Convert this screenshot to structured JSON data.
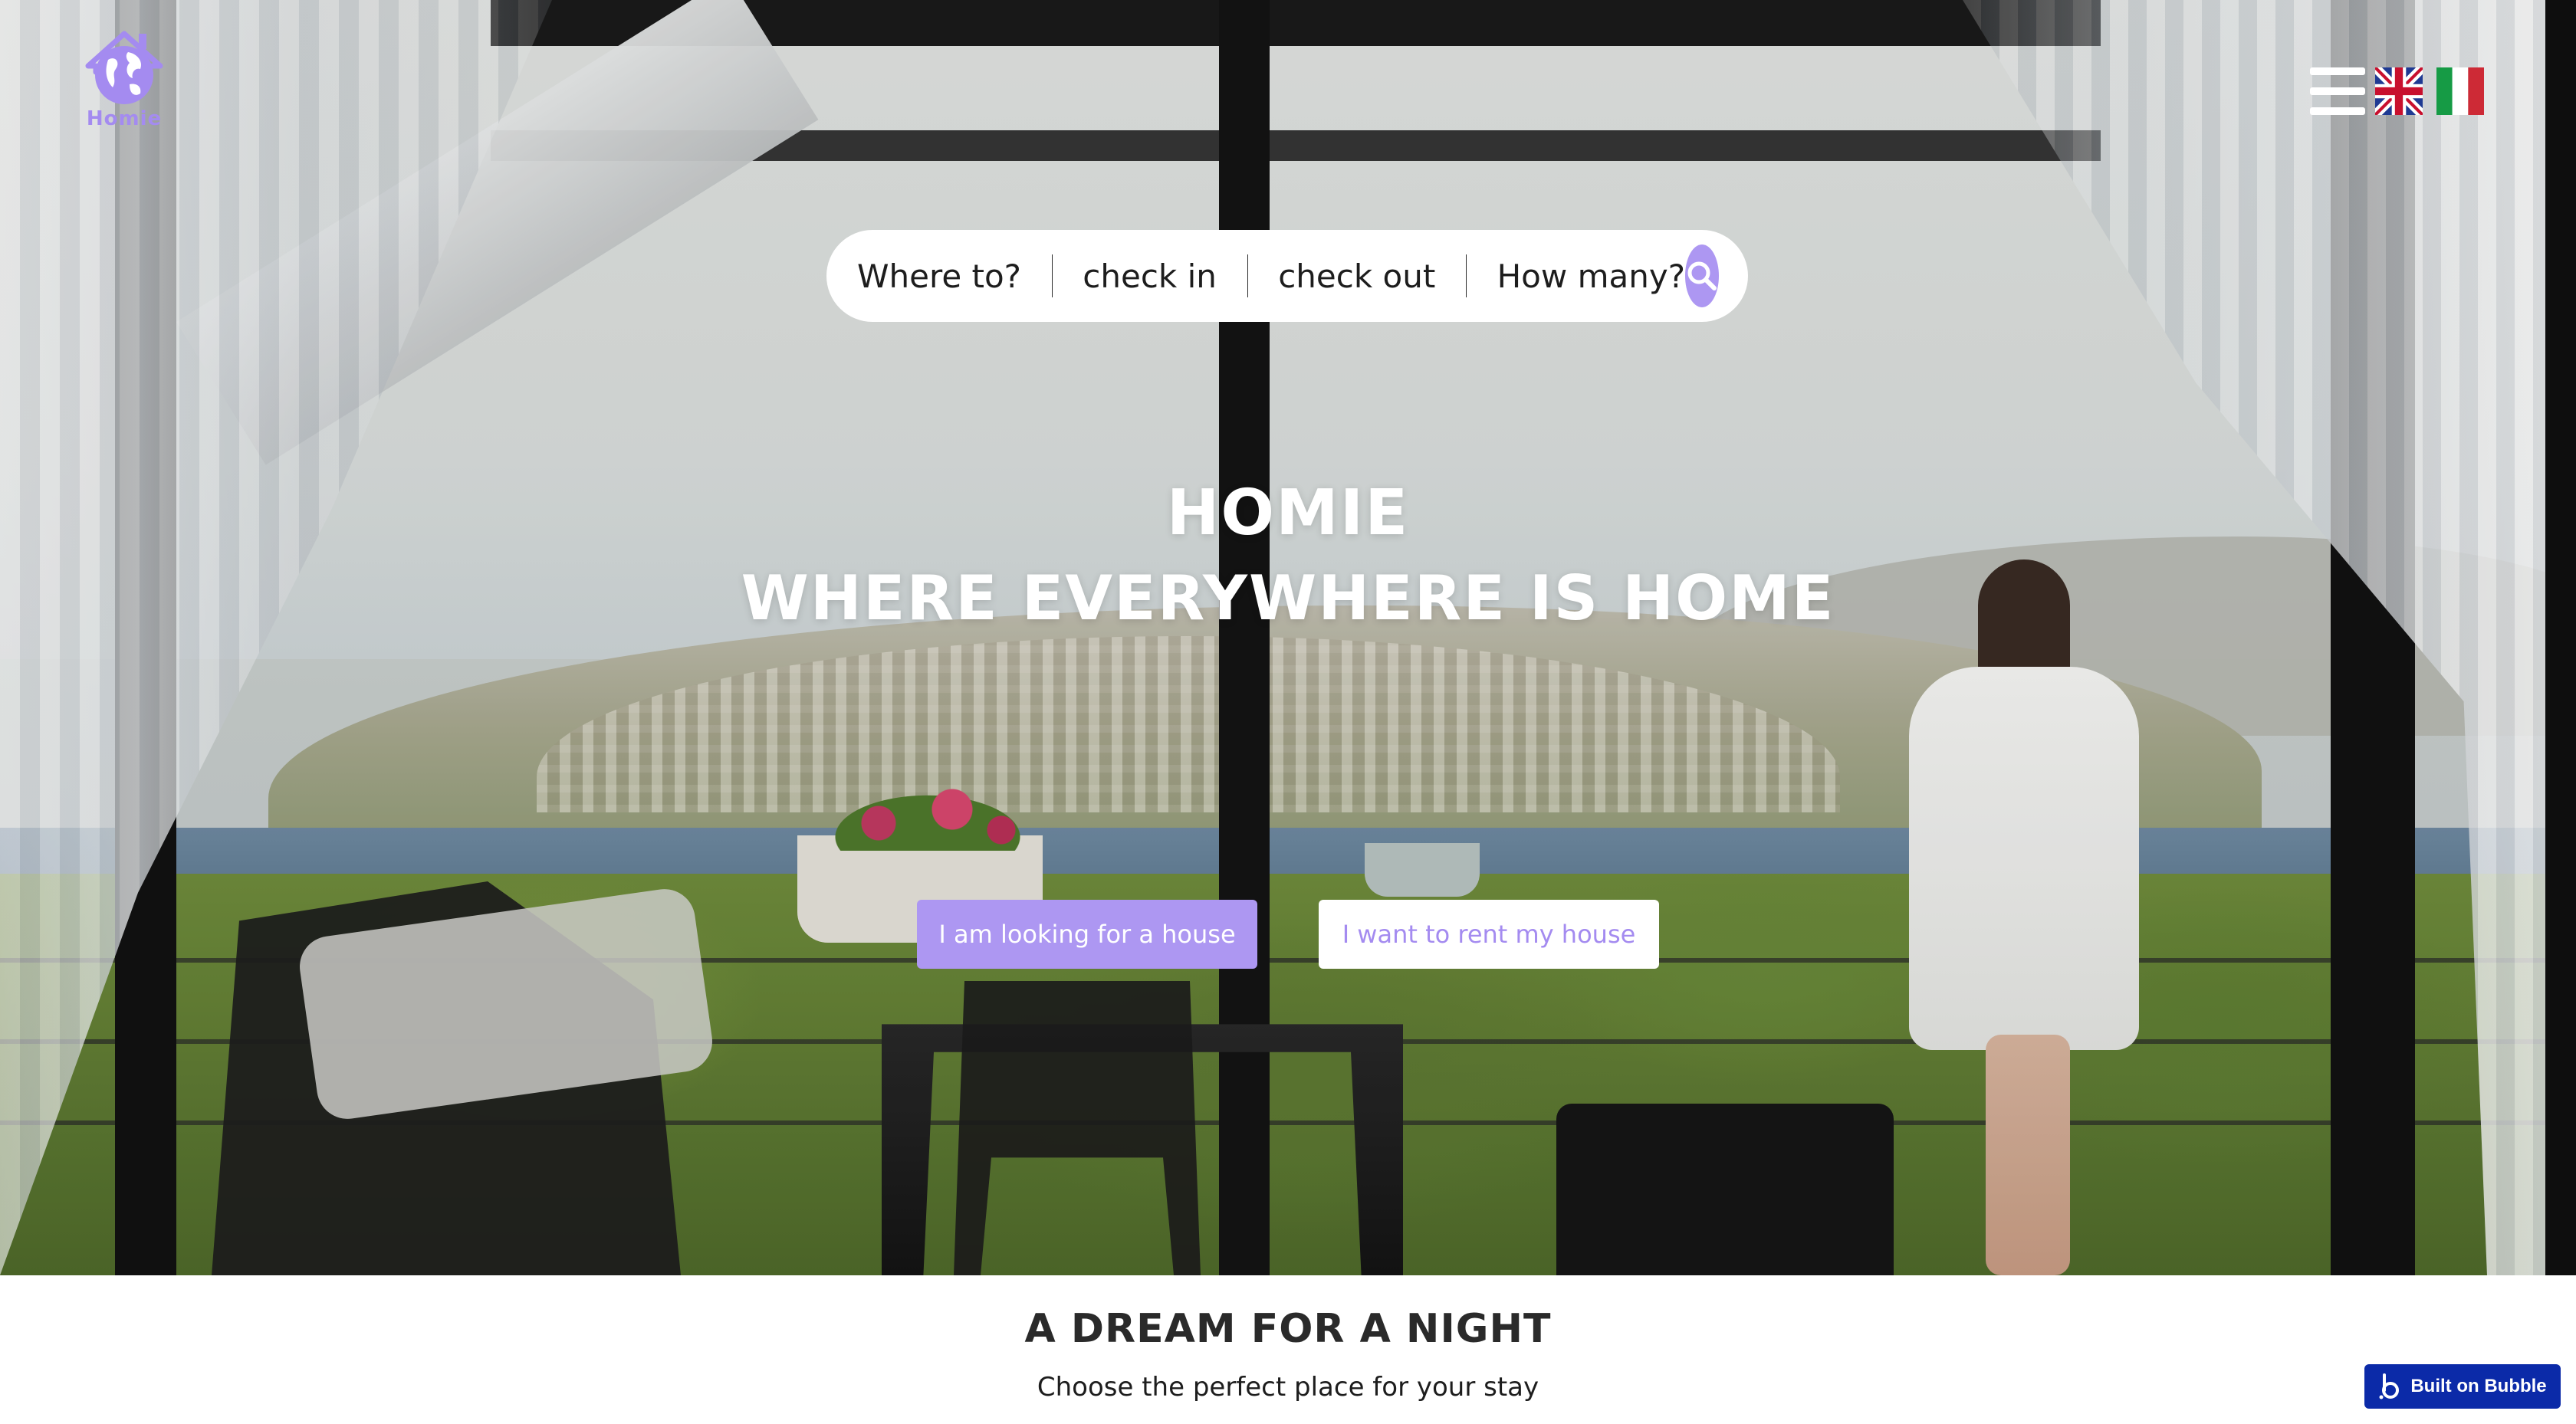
{
  "brand": {
    "logo_text": "Homie",
    "accent_color": "#ad97f2"
  },
  "header": {
    "menu_icon": "hamburger-menu-icon",
    "languages": [
      {
        "code": "en",
        "icon": "uk-flag-icon"
      },
      {
        "code": "it",
        "icon": "italy-flag-icon"
      }
    ]
  },
  "search": {
    "where": "Where to?",
    "check_in": "check in",
    "check_out": "check out",
    "guests": "How many?",
    "button_icon": "search-icon"
  },
  "hero": {
    "title_line1": "HOMIE",
    "title_line2": "WHERE EVERYWHERE IS HOME",
    "cta_primary": "I am looking for a house",
    "cta_secondary": "I want to rent my house"
  },
  "section": {
    "title": "A DREAM FOR A NIGHT",
    "subtitle": "Choose the perfect place for your stay"
  },
  "badge": {
    "label": "Built on Bubble",
    "icon": "bubble-logo-icon"
  }
}
